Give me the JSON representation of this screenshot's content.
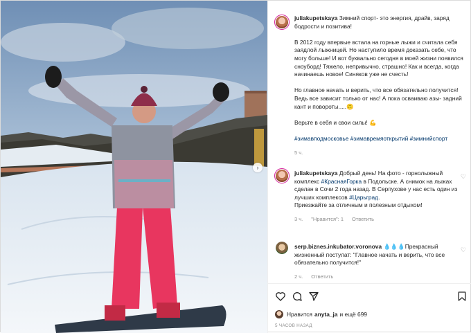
{
  "photo": {
    "description_icon": "photo-of-snowboarder",
    "next_icon": "chevron-right-icon"
  },
  "post": {
    "author": "juliakupetskaya",
    "caption_intro": "Зимний спорт- это энергия, драйв, заряд бодрости и позитива!",
    "caption_p2": "В 2012 году впервые встала на горные лыжи и считала себя заядлой лыжницей. Но наступило время доказать себе, что могу больше! И вот буквально сегодня в моей жизни появился сноуборд! Тяжело, непривычно, страшно! Как и всегда, когда начинаешь новое! Синяков уже не счесть!",
    "caption_p3": "Но главное начать и верить, что все обязательно получится! Ведь все зависит только от нас! А пока осваиваю азы- задний кант и повороты.....🙃",
    "caption_p4": "Верьте в себя и свои силы! 💪",
    "hashtags": [
      "#зимавподмосковье",
      "#зимавремяоткрытий",
      "#зимнийспорт"
    ],
    "age": "5 ч."
  },
  "comments": [
    {
      "author": "juliakupetskaya",
      "text_before": "Добрый день! На фото - горнолыжный комплекс ",
      "tag1": "#КраснаяГорка",
      "text_mid": " в Подольске. А снимок на лыжах сделан в Сочи 2 года назад. В Серпухове у нас есть один из лучших комплексов ",
      "tag2": "#Царьград",
      "text_after": ".",
      "line2": "Приезжайте за отличным и полезным отдыхом!",
      "age": "3 ч.",
      "likes": "\"Нравится\": 1",
      "reply": "Ответить"
    },
    {
      "author": "serp.biznes.inkubator.voronova",
      "text": "💧💧💧Прекрасный жизненный постулат: \"Главное начать и верить, что все обязательно получится!\"",
      "age": "2 ч.",
      "reply": "Ответить"
    }
  ],
  "actions": {
    "like_icon": "heart-icon",
    "comment_icon": "comment-icon",
    "share_icon": "paper-plane-icon",
    "save_icon": "bookmark-icon"
  },
  "likes": {
    "prefix": "Нравится",
    "user": "anyta_ja",
    "suffix": "и ещё 699"
  },
  "timestamp": "5 ЧАСОВ НАЗАД"
}
